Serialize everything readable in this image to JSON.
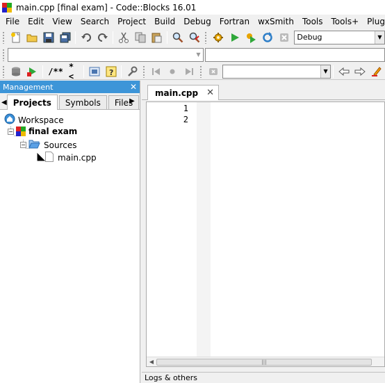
{
  "window": {
    "title": "main.cpp [final exam] - Code::Blocks 16.01"
  },
  "menu": [
    "File",
    "Edit",
    "View",
    "Search",
    "Project",
    "Build",
    "Debug",
    "Fortran",
    "wxSmith",
    "Tools",
    "Tools+",
    "Plugins"
  ],
  "toolbar": {
    "build_target": "Debug",
    "comment_label": "/**",
    "doxy_label": "*<"
  },
  "management": {
    "title": "Management",
    "close": "✕",
    "tabs": [
      "Projects",
      "Symbols",
      "Files"
    ],
    "tree": {
      "workspace": "Workspace",
      "project": "final exam",
      "folder": "Sources",
      "file": "main.cpp"
    }
  },
  "editor": {
    "tab_label": "main.cpp",
    "tab_close": "✕",
    "line_numbers": [
      "1",
      "2"
    ]
  },
  "logs": {
    "label": "Logs & others"
  },
  "colors": {
    "accent": "#3d95d8",
    "window": "#f0f0f0"
  }
}
